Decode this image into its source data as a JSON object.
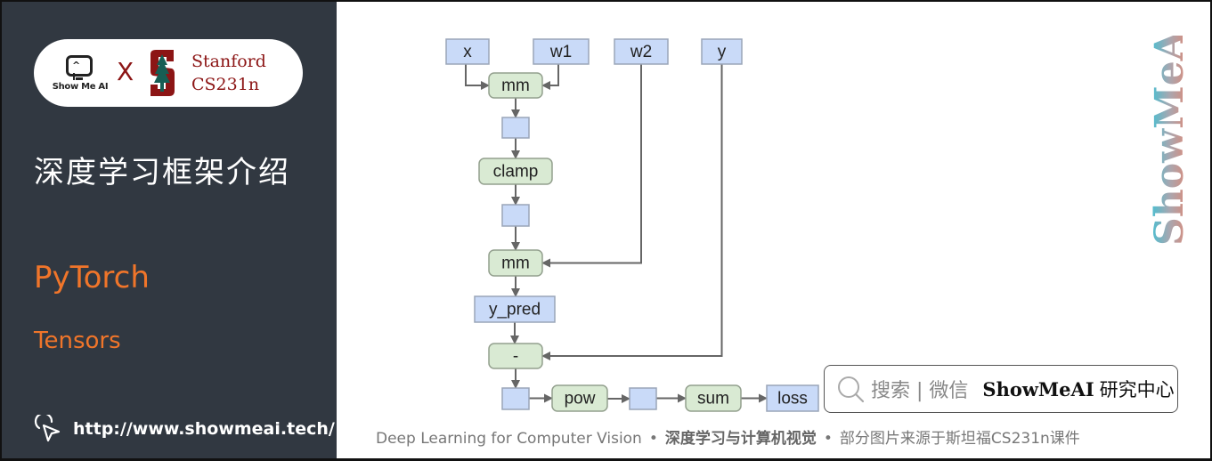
{
  "sidebar": {
    "logo": {
      "showmeai_text": "Show Me AI",
      "face": "^ I",
      "cross": "X",
      "stanford_line1": "Stanford",
      "stanford_line2": "CS231n"
    },
    "title": "深度学习框架介绍",
    "section": "PyTorch",
    "subsection": "Tensors",
    "link": {
      "icon": "cursor-click-icon",
      "url": "http://www.showmeai.tech/"
    }
  },
  "watermark": "ShowMeAI",
  "graph": {
    "colors": {
      "tensor_fill": "#c9daf8",
      "tensor_stroke": "#9aa5b8",
      "op_fill": "#d9ead3",
      "op_stroke": "#93a08e",
      "edge": "#666666"
    },
    "nodes": [
      {
        "id": "x",
        "label": "x",
        "kind": "tensor"
      },
      {
        "id": "w1",
        "label": "w1",
        "kind": "tensor"
      },
      {
        "id": "w2",
        "label": "w2",
        "kind": "tensor"
      },
      {
        "id": "y",
        "label": "y",
        "kind": "tensor"
      },
      {
        "id": "mm1",
        "label": "mm",
        "kind": "op"
      },
      {
        "id": "h",
        "label": "",
        "kind": "tensor"
      },
      {
        "id": "clamp",
        "label": "clamp",
        "kind": "op"
      },
      {
        "id": "h_relu",
        "label": "",
        "kind": "tensor"
      },
      {
        "id": "mm2",
        "label": "mm",
        "kind": "op"
      },
      {
        "id": "y_pred",
        "label": "y_pred",
        "kind": "tensor"
      },
      {
        "id": "minus",
        "label": "-",
        "kind": "op"
      },
      {
        "id": "diff",
        "label": "",
        "kind": "tensor"
      },
      {
        "id": "pow",
        "label": "pow",
        "kind": "op"
      },
      {
        "id": "sq",
        "label": "",
        "kind": "tensor"
      },
      {
        "id": "sum",
        "label": "sum",
        "kind": "op"
      },
      {
        "id": "loss",
        "label": "loss",
        "kind": "tensor"
      }
    ],
    "edges": [
      [
        "x",
        "mm1"
      ],
      [
        "w1",
        "mm1"
      ],
      [
        "mm1",
        "h"
      ],
      [
        "h",
        "clamp"
      ],
      [
        "clamp",
        "h_relu"
      ],
      [
        "h_relu",
        "mm2"
      ],
      [
        "w2",
        "mm2"
      ],
      [
        "mm2",
        "y_pred"
      ],
      [
        "y_pred",
        "minus"
      ],
      [
        "y",
        "minus"
      ],
      [
        "minus",
        "diff"
      ],
      [
        "diff",
        "pow"
      ],
      [
        "pow",
        "sq"
      ],
      [
        "sq",
        "sum"
      ],
      [
        "sum",
        "loss"
      ]
    ]
  },
  "search": {
    "icon": "search-icon",
    "label": "搜索 | 微信",
    "brand": "ShowMeAI",
    "brand_suffix": "研究中心"
  },
  "footer": {
    "part1": "Deep Learning for Computer Vision",
    "sep": "•",
    "part2": "深度学习与计算机视觉",
    "part3": "部分图片来源于斯坦福CS231n课件"
  }
}
